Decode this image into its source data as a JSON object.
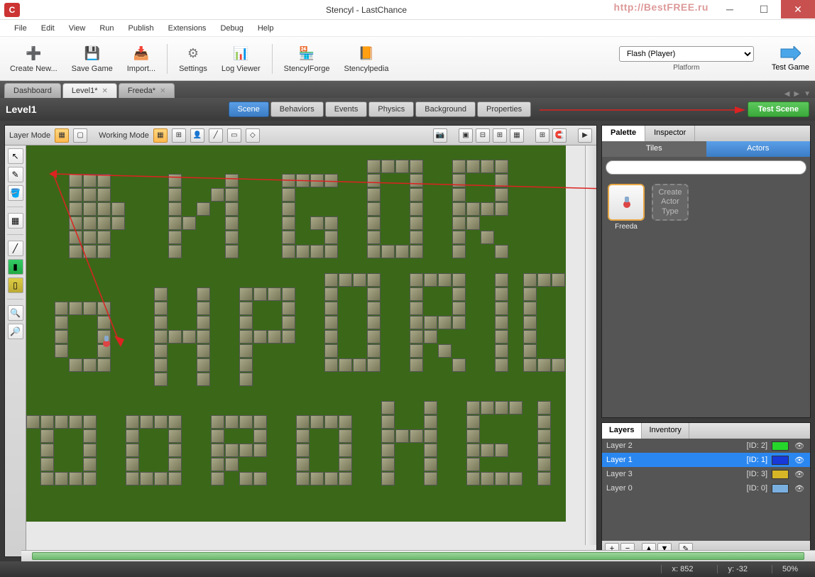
{
  "window": {
    "title": "Stencyl - LastChance",
    "watermark": "http://BestFREE.ru"
  },
  "menubar": [
    "File",
    "Edit",
    "View",
    "Run",
    "Publish",
    "Extensions",
    "Debug",
    "Help"
  ],
  "toolbar": {
    "create_new": "Create New...",
    "save_game": "Save Game",
    "import": "Import...",
    "settings": "Settings",
    "log_viewer": "Log Viewer",
    "stencylforge": "StencylForge",
    "stencylpedia": "Stencylpedia",
    "platform_label": "Platform",
    "platform_value": "Flash (Player)",
    "test_game": "Test Game"
  },
  "doc_tabs": [
    {
      "label": "Dashboard",
      "closable": false,
      "active": false
    },
    {
      "label": "Level1*",
      "closable": true,
      "active": true
    },
    {
      "label": "Freeda*",
      "closable": true,
      "active": false
    }
  ],
  "scene": {
    "title": "Level1",
    "mode_tabs": [
      "Scene",
      "Behaviors",
      "Events",
      "Physics",
      "Background",
      "Properties"
    ],
    "active_mode": "Scene",
    "test_scene_btn": "Test Scene",
    "layer_mode_label": "Layer Mode",
    "working_mode_label": "Working Mode"
  },
  "palette": {
    "tabs": [
      "Palette",
      "Inspector"
    ],
    "active_tab": "Palette",
    "subtabs": [
      "Tiles",
      "Actors"
    ],
    "active_subtab": "Actors",
    "search_placeholder": "",
    "actor_name": "Freeda",
    "create_actor_text": "Create Actor Type"
  },
  "layers": {
    "tabs": [
      "Layers",
      "Inventory"
    ],
    "active_tab": "Layers",
    "rows": [
      {
        "name": "Layer 2",
        "id": "[ID: 2]",
        "color": "#26d62a",
        "selected": false
      },
      {
        "name": "Layer 1",
        "id": "[ID: 1]",
        "color": "#1838d8",
        "selected": true
      },
      {
        "name": "Layer 3",
        "id": "[ID: 3]",
        "color": "#d6b626",
        "selected": false
      },
      {
        "name": "Layer 0",
        "id": "[ID: 0]",
        "color": "#7ab0e0",
        "selected": false
      }
    ]
  },
  "statusbar": {
    "x_label": "x:",
    "x": "852",
    "y_label": "y:",
    "y": "-32",
    "zoom": "50%"
  },
  "tiles": {
    "cell": 20,
    "coords": [
      [
        3,
        2
      ],
      [
        3,
        3
      ],
      [
        3,
        4
      ],
      [
        3,
        5
      ],
      [
        3,
        6
      ],
      [
        3,
        7
      ],
      [
        4,
        2
      ],
      [
        4,
        3
      ],
      [
        4,
        4
      ],
      [
        4,
        5
      ],
      [
        4,
        6
      ],
      [
        4,
        7
      ],
      [
        5,
        2
      ],
      [
        5,
        3
      ],
      [
        5,
        4
      ],
      [
        5,
        5
      ],
      [
        5,
        6
      ],
      [
        5,
        7
      ],
      [
        6,
        4
      ],
      [
        6,
        5
      ],
      [
        10,
        2
      ],
      [
        10,
        3
      ],
      [
        10,
        4
      ],
      [
        10,
        5
      ],
      [
        10,
        6
      ],
      [
        10,
        7
      ],
      [
        11,
        5
      ],
      [
        12,
        4
      ],
      [
        13,
        3
      ],
      [
        14,
        2
      ],
      [
        14,
        3
      ],
      [
        14,
        4
      ],
      [
        14,
        5
      ],
      [
        14,
        6
      ],
      [
        14,
        7
      ],
      [
        18,
        2
      ],
      [
        19,
        2
      ],
      [
        20,
        2
      ],
      [
        21,
        2
      ],
      [
        18,
        3
      ],
      [
        18,
        4
      ],
      [
        18,
        5
      ],
      [
        18,
        6
      ],
      [
        18,
        7
      ],
      [
        19,
        7
      ],
      [
        20,
        7
      ],
      [
        21,
        7
      ],
      [
        21,
        6
      ],
      [
        21,
        5
      ],
      [
        20,
        5
      ],
      [
        24,
        1
      ],
      [
        24,
        2
      ],
      [
        24,
        3
      ],
      [
        24,
        4
      ],
      [
        24,
        5
      ],
      [
        24,
        6
      ],
      [
        24,
        7
      ],
      [
        25,
        1
      ],
      [
        26,
        1
      ],
      [
        27,
        1
      ],
      [
        27,
        2
      ],
      [
        27,
        3
      ],
      [
        27,
        4
      ],
      [
        27,
        5
      ],
      [
        27,
        6
      ],
      [
        27,
        7
      ],
      [
        25,
        7
      ],
      [
        26,
        7
      ],
      [
        30,
        1
      ],
      [
        30,
        2
      ],
      [
        30,
        3
      ],
      [
        30,
        4
      ],
      [
        30,
        5
      ],
      [
        30,
        6
      ],
      [
        30,
        7
      ],
      [
        31,
        1
      ],
      [
        32,
        1
      ],
      [
        33,
        1
      ],
      [
        33,
        2
      ],
      [
        33,
        3
      ],
      [
        31,
        4
      ],
      [
        32,
        4
      ],
      [
        33,
        4
      ],
      [
        31,
        5
      ],
      [
        32,
        6
      ],
      [
        33,
        7
      ],
      [
        2,
        11
      ],
      [
        2,
        12
      ],
      [
        2,
        13
      ],
      [
        2,
        14
      ],
      [
        3,
        11
      ],
      [
        3,
        15
      ],
      [
        4,
        11
      ],
      [
        4,
        15
      ],
      [
        5,
        11
      ],
      [
        5,
        15
      ],
      [
        5,
        12
      ],
      [
        5,
        13
      ],
      [
        5,
        14
      ],
      [
        9,
        10
      ],
      [
        9,
        11
      ],
      [
        9,
        12
      ],
      [
        9,
        13
      ],
      [
        9,
        14
      ],
      [
        9,
        15
      ],
      [
        9,
        16
      ],
      [
        10,
        13
      ],
      [
        11,
        13
      ],
      [
        12,
        10
      ],
      [
        12,
        11
      ],
      [
        12,
        12
      ],
      [
        12,
        13
      ],
      [
        12,
        14
      ],
      [
        12,
        15
      ],
      [
        12,
        16
      ],
      [
        15,
        10
      ],
      [
        15,
        11
      ],
      [
        15,
        12
      ],
      [
        15,
        13
      ],
      [
        15,
        14
      ],
      [
        15,
        15
      ],
      [
        15,
        16
      ],
      [
        16,
        10
      ],
      [
        17,
        10
      ],
      [
        18,
        10
      ],
      [
        18,
        11
      ],
      [
        18,
        12
      ],
      [
        16,
        13
      ],
      [
        17,
        13
      ],
      [
        18,
        13
      ],
      [
        21,
        9
      ],
      [
        22,
        9
      ],
      [
        23,
        9
      ],
      [
        24,
        9
      ],
      [
        21,
        10
      ],
      [
        21,
        11
      ],
      [
        21,
        12
      ],
      [
        21,
        13
      ],
      [
        21,
        14
      ],
      [
        21,
        15
      ],
      [
        22,
        15
      ],
      [
        23,
        15
      ],
      [
        24,
        15
      ],
      [
        24,
        14
      ],
      [
        24,
        13
      ],
      [
        24,
        12
      ],
      [
        24,
        11
      ],
      [
        24,
        10
      ],
      [
        27,
        9
      ],
      [
        27,
        10
      ],
      [
        27,
        11
      ],
      [
        27,
        12
      ],
      [
        27,
        13
      ],
      [
        27,
        14
      ],
      [
        27,
        15
      ],
      [
        28,
        9
      ],
      [
        29,
        9
      ],
      [
        30,
        9
      ],
      [
        30,
        10
      ],
      [
        30,
        11
      ],
      [
        30,
        12
      ],
      [
        28,
        12
      ],
      [
        29,
        12
      ],
      [
        28,
        13
      ],
      [
        29,
        14
      ],
      [
        30,
        15
      ],
      [
        33,
        9
      ],
      [
        33,
        10
      ],
      [
        33,
        11
      ],
      [
        33,
        12
      ],
      [
        33,
        13
      ],
      [
        33,
        14
      ],
      [
        33,
        15
      ],
      [
        35,
        9
      ],
      [
        35,
        10
      ],
      [
        35,
        11
      ],
      [
        35,
        12
      ],
      [
        35,
        13
      ],
      [
        35,
        14
      ],
      [
        35,
        15
      ],
      [
        36,
        9
      ],
      [
        37,
        9
      ],
      [
        36,
        15
      ],
      [
        37,
        15
      ],
      [
        0,
        19
      ],
      [
        1,
        19
      ],
      [
        2,
        19
      ],
      [
        3,
        19
      ],
      [
        4,
        19
      ],
      [
        1,
        20
      ],
      [
        1,
        21
      ],
      [
        1,
        22
      ],
      [
        1,
        23
      ],
      [
        2,
        23
      ],
      [
        3,
        23
      ],
      [
        4,
        23
      ],
      [
        4,
        22
      ],
      [
        4,
        21
      ],
      [
        4,
        20
      ],
      [
        7,
        19
      ],
      [
        8,
        19
      ],
      [
        9,
        19
      ],
      [
        10,
        19
      ],
      [
        7,
        20
      ],
      [
        7,
        21
      ],
      [
        7,
        22
      ],
      [
        7,
        23
      ],
      [
        10,
        20
      ],
      [
        10,
        21
      ],
      [
        10,
        22
      ],
      [
        10,
        23
      ],
      [
        8,
        23
      ],
      [
        9,
        23
      ],
      [
        13,
        19
      ],
      [
        13,
        20
      ],
      [
        13,
        21
      ],
      [
        13,
        22
      ],
      [
        13,
        23
      ],
      [
        14,
        19
      ],
      [
        15,
        19
      ],
      [
        16,
        19
      ],
      [
        16,
        20
      ],
      [
        16,
        21
      ],
      [
        14,
        21
      ],
      [
        15,
        21
      ],
      [
        14,
        22
      ],
      [
        15,
        23
      ],
      [
        16,
        23
      ],
      [
        19,
        19
      ],
      [
        19,
        20
      ],
      [
        19,
        21
      ],
      [
        19,
        22
      ],
      [
        19,
        23
      ],
      [
        20,
        19
      ],
      [
        21,
        19
      ],
      [
        22,
        19
      ],
      [
        22,
        20
      ],
      [
        22,
        21
      ],
      [
        22,
        22
      ],
      [
        22,
        23
      ],
      [
        20,
        23
      ],
      [
        21,
        23
      ],
      [
        25,
        18
      ],
      [
        25,
        19
      ],
      [
        25,
        20
      ],
      [
        25,
        21
      ],
      [
        25,
        22
      ],
      [
        25,
        23
      ],
      [
        26,
        20
      ],
      [
        27,
        20
      ],
      [
        28,
        18
      ],
      [
        28,
        19
      ],
      [
        28,
        20
      ],
      [
        28,
        21
      ],
      [
        28,
        22
      ],
      [
        28,
        23
      ],
      [
        31,
        18
      ],
      [
        31,
        19
      ],
      [
        31,
        20
      ],
      [
        31,
        21
      ],
      [
        31,
        22
      ],
      [
        31,
        23
      ],
      [
        32,
        18
      ],
      [
        33,
        18
      ],
      [
        34,
        18
      ],
      [
        32,
        21
      ],
      [
        33,
        21
      ],
      [
        32,
        23
      ],
      [
        33,
        23
      ],
      [
        34,
        23
      ],
      [
        36,
        18
      ],
      [
        36,
        19
      ],
      [
        36,
        20
      ],
      [
        36,
        21
      ],
      [
        36,
        22
      ],
      [
        36,
        23
      ]
    ]
  }
}
